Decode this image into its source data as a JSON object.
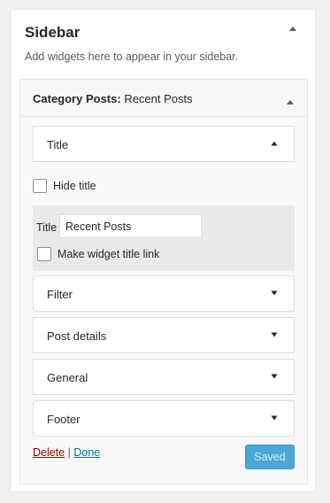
{
  "sidebar": {
    "title": "Sidebar",
    "description": "Add widgets here to appear in your sidebar.",
    "toggle_icon": "triangle-up-icon"
  },
  "widget": {
    "title_bold": "Category Posts:",
    "title_sub": " Recent Posts",
    "toggle_icon": "triangle-up-icon"
  },
  "sections": {
    "title": {
      "label": "Title",
      "state": "expanded"
    },
    "filter": {
      "label": "Filter",
      "state": "collapsed"
    },
    "post_details": {
      "label": "Post details",
      "state": "collapsed"
    },
    "general": {
      "label": "General",
      "state": "collapsed"
    },
    "footer": {
      "label": "Footer",
      "state": "collapsed"
    }
  },
  "title_section": {
    "hide_title_label": "Hide title",
    "hide_title_checked": false,
    "title_field_label": "Title",
    "title_field_value": "Recent Posts",
    "make_link_label": "Make widget title link",
    "make_link_checked": false
  },
  "actions": {
    "delete_label": "Delete",
    "separator": "|",
    "done_label": "Done",
    "saved_label": "Saved"
  },
  "colors": {
    "accent": "#0073aa",
    "delete": "#aa0000",
    "saved_button": "#4aa8d8",
    "panel_bg": "#ffffff",
    "page_bg": "#f1f1f1"
  }
}
